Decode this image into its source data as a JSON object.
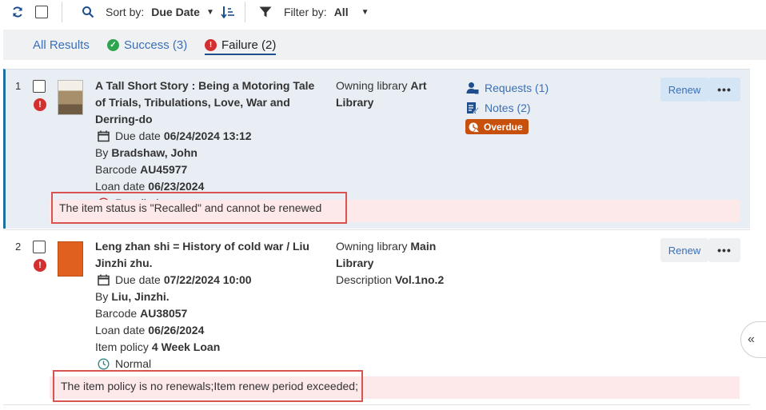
{
  "toolbar": {
    "sort_label": "Sort by:",
    "sort_value": "Due Date",
    "filter_label": "Filter by:",
    "filter_value": "All"
  },
  "tabs": [
    {
      "label": "All Results",
      "count": ""
    },
    {
      "label": "Success (3)",
      "icon": "check-circle-icon"
    },
    {
      "label": "Failure (2)",
      "icon": "exclamation-circle-icon"
    }
  ],
  "rows": [
    {
      "num": "1",
      "title": "A Tall Short Story : Being a Motoring Tale of Trials, Tribulations, Love, War and Derring-do",
      "due_label": "Due date",
      "due_value": "06/24/2024 13:12",
      "by_label": "By",
      "by_value": "Bradshaw, John",
      "barcode_label": "Barcode",
      "barcode_value": "AU45977",
      "loan_label": "Loan date",
      "loan_value": "06/23/2024",
      "status": "Recalled",
      "owning_label": "Owning library",
      "owning_value": "Art Library",
      "requests": "Requests (1)",
      "notes": "Notes (2)",
      "badge": "Overdue",
      "renew": "Renew",
      "more": "•••",
      "error": "The item status is \"Recalled\" and cannot be renewed"
    },
    {
      "num": "2",
      "title": "Leng zhan shi = History of cold war / Liu Jinzhi zhu.",
      "due_label": "Due date",
      "due_value": "07/22/2024 10:00",
      "by_label": "By",
      "by_value": "Liu, Jinzhi.",
      "barcode_label": "Barcode",
      "barcode_value": "AU38057",
      "loan_label": "Loan date",
      "loan_value": "06/26/2024",
      "policy_label": "Item policy",
      "policy_value": "4 Week Loan",
      "status": "Normal",
      "owning_label": "Owning library",
      "owning_value": "Main Library",
      "desc_label": "Description",
      "desc_value": "Vol.1no.2",
      "renew": "Renew",
      "more": "•••",
      "error": "The item policy is no renewals;Item renew period exceeded;"
    }
  ],
  "side_toggle": "«",
  "colors": {
    "accent": "#3b6fb6",
    "error": "#d32f2f",
    "overdue": "#c8500d",
    "selected_row": "#e8eef3"
  }
}
